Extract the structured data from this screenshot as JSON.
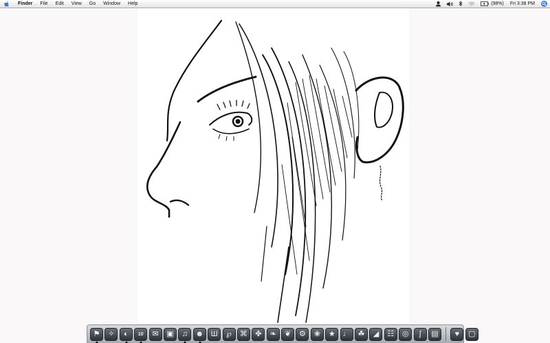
{
  "menubar": {
    "apple_icon": "apple-icon",
    "items": [
      "Finder",
      "File",
      "Edit",
      "View",
      "Go",
      "Window",
      "Help"
    ],
    "status": {
      "icons": [
        "user-icon",
        "volume-icon",
        "bluetooth-icon",
        "wifi-icon",
        "battery-icon"
      ],
      "battery_text": "(98%)",
      "clock": "Fri 3:38 PM",
      "spotlight_icon": "spotlight-icon"
    }
  },
  "desktop": {
    "wallpaper": "sketch-face-profile"
  },
  "dock": {
    "apps": [
      {
        "name": "finder",
        "glyph": "⚑",
        "running": true
      },
      {
        "name": "dashboard",
        "glyph": "✧",
        "running": false
      },
      {
        "name": "safari",
        "glyph": "◐",
        "running": true
      },
      {
        "name": "ical",
        "glyph": "10",
        "running": true
      },
      {
        "name": "mail",
        "glyph": "✉",
        "running": false
      },
      {
        "name": "iphoto",
        "glyph": "▣",
        "running": false
      },
      {
        "name": "itunes",
        "glyph": "♫",
        "running": true
      },
      {
        "name": "ichat",
        "glyph": "☻",
        "running": true
      },
      {
        "name": "app-w",
        "glyph": "Ш",
        "running": false
      },
      {
        "name": "app-p",
        "glyph": "℘",
        "running": false
      },
      {
        "name": "app-h",
        "glyph": "⌘",
        "running": false
      },
      {
        "name": "app-fan",
        "glyph": "✤",
        "running": false
      },
      {
        "name": "app-leaf",
        "glyph": "❧",
        "running": false
      },
      {
        "name": "app-feather",
        "glyph": "❦",
        "running": false
      },
      {
        "name": "app-gear",
        "glyph": "⚙",
        "running": false
      },
      {
        "name": "app-bird",
        "glyph": "❀",
        "running": false
      },
      {
        "name": "app-star",
        "glyph": "★",
        "running": false
      },
      {
        "name": "app-note",
        "glyph": "♩",
        "running": false
      },
      {
        "name": "app-duck",
        "glyph": "☘",
        "running": false
      },
      {
        "name": "app-fin",
        "glyph": "◢",
        "running": false
      },
      {
        "name": "app-grid",
        "glyph": "☷",
        "running": false
      },
      {
        "name": "app-disc",
        "glyph": "◎",
        "running": false
      },
      {
        "name": "app-script",
        "glyph": "∫",
        "running": false
      },
      {
        "name": "app-box",
        "glyph": "▤",
        "running": false
      }
    ],
    "stacks": [
      {
        "name": "downloads-stack",
        "glyph": "♥"
      },
      {
        "name": "trash",
        "glyph": "▢"
      }
    ]
  }
}
